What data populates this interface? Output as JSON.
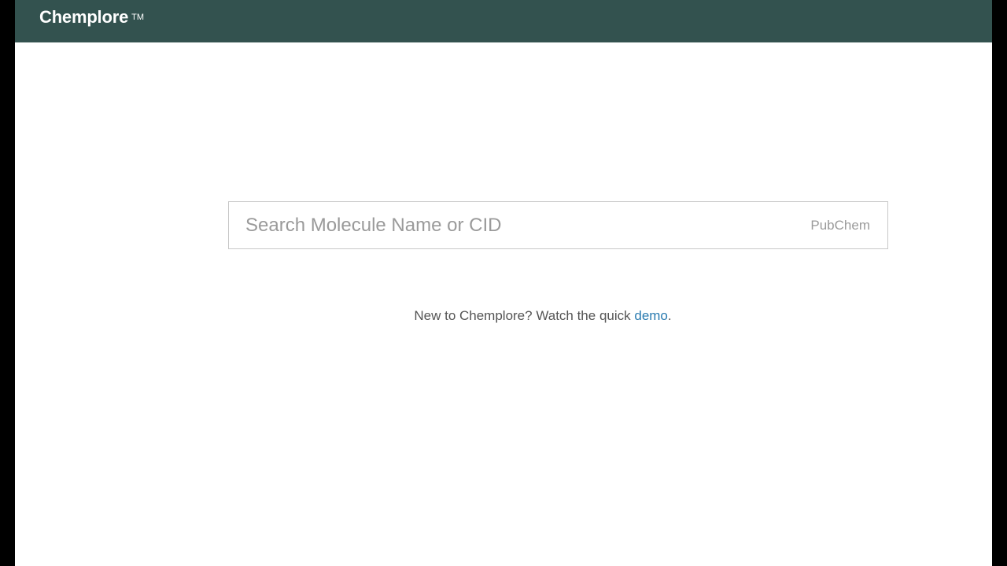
{
  "header": {
    "brand_name": "Chemplore",
    "trademark": "TM",
    "background_color": "#33524f"
  },
  "search": {
    "placeholder": "Search Molecule Name or CID",
    "value": "",
    "source_label": "PubChem"
  },
  "helper": {
    "prefix": "New to Chemplore? Watch the quick ",
    "link_label": "demo",
    "suffix": ".",
    "link_color": "#2a7bb0"
  }
}
